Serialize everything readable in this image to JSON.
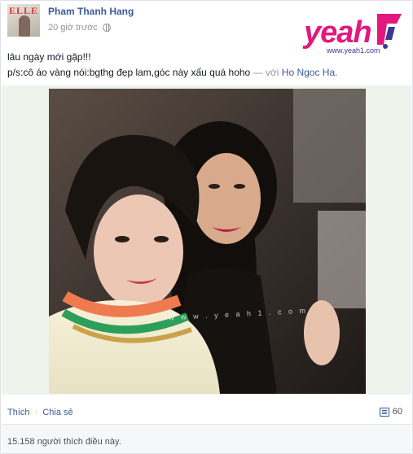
{
  "post": {
    "author": "Pham Thanh Hang",
    "timestamp": "20 giờ trước",
    "privacy_icon": "globe-icon",
    "avatar_mag_text": "ELLE",
    "text_line1": "lâu ngày mới gặp!!!",
    "text_line2": "p/s:cô áo vàng nói:bgthg đẹp lam,góc này xấu quá hoho",
    "with_label": "— với",
    "tagged_name": "Ho Ngoc Ha."
  },
  "watermark": {
    "logo_text": "yeah",
    "logo_url": "www.yeah1.com",
    "photo_watermark": "w w w . y e a h 1 . c o m"
  },
  "footer": {
    "like_label": "Thích",
    "separator": "·",
    "share_label": "Chia sẻ",
    "comment_count": "60",
    "likes_text": "15.158 người thích điều này."
  },
  "colors": {
    "link": "#3b5998",
    "brand_pink": "#e2187e",
    "photo_bg": "#eef3eb"
  }
}
